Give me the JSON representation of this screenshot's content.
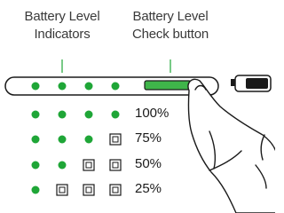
{
  "callouts": {
    "indicators": {
      "line1": "Battery Level",
      "line2": "Indicators"
    },
    "check_button": {
      "line1": "Battery Level",
      "line2": "Check button"
    }
  },
  "colors": {
    "led_on": "#1fa637",
    "button_green": "#3fb54a",
    "callout_line": "#1fa637",
    "outline": "#1a1a1a"
  },
  "levels": [
    {
      "label": "100%",
      "leds": [
        "on",
        "on",
        "on",
        "on"
      ]
    },
    {
      "label": "75%",
      "leds": [
        "on",
        "on",
        "on",
        "off"
      ]
    },
    {
      "label": "50%",
      "leds": [
        "on",
        "on",
        "off",
        "off"
      ]
    },
    {
      "label": "25%",
      "leds": [
        "on",
        "off",
        "off",
        "off"
      ]
    }
  ],
  "icons": {
    "battery": "battery-icon",
    "hand": "pointing-hand-icon"
  }
}
